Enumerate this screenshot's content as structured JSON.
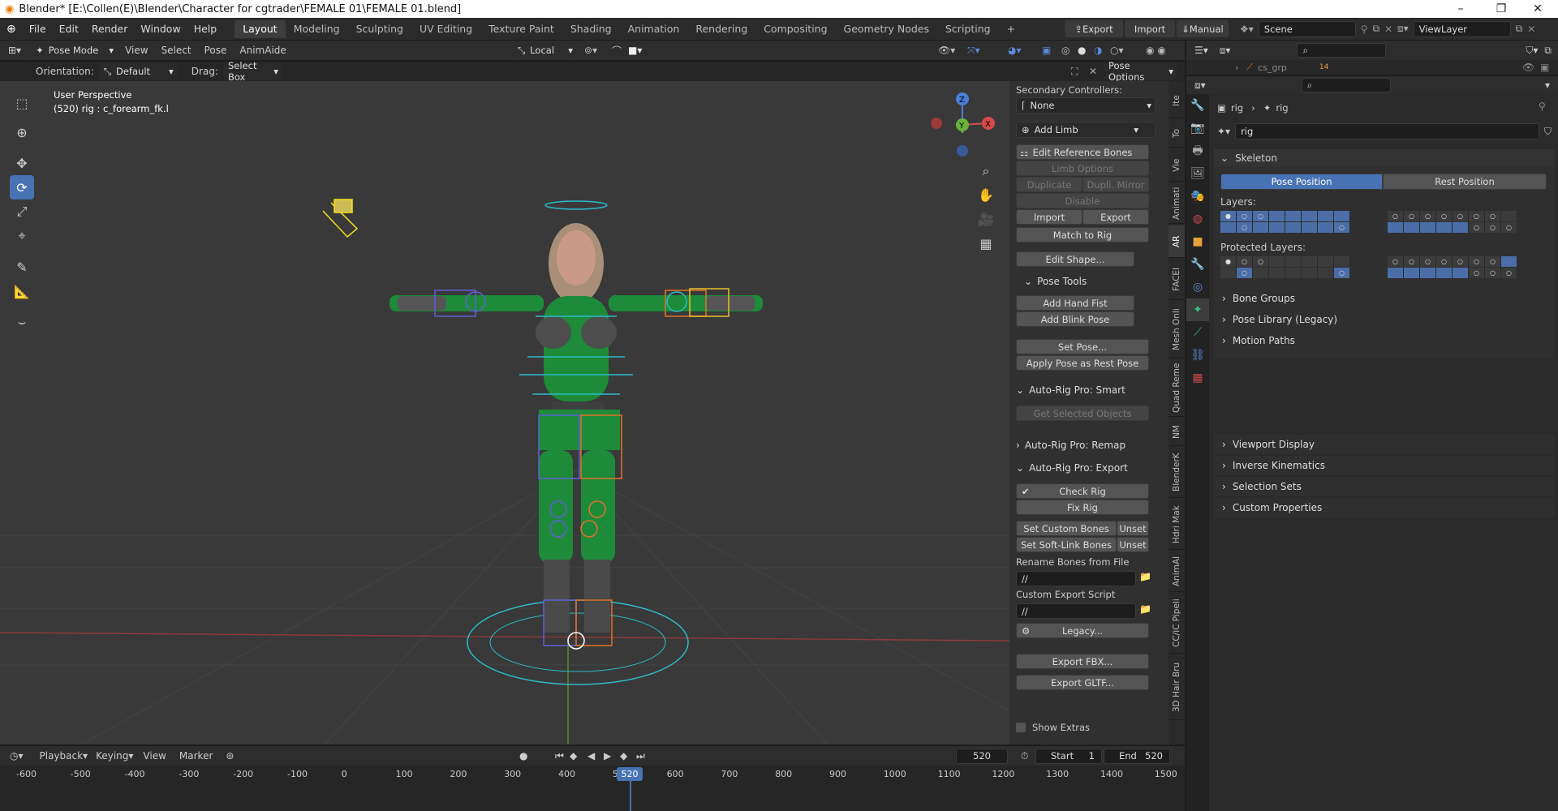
{
  "window": {
    "title": "Blender* [E:\\Collen(E)\\Blender\\Character for cgtrader\\FEMALE 01\\FEMALE 01.blend]",
    "minimize": "–",
    "maximize": "❐",
    "close": "✕"
  },
  "menu": [
    "File",
    "Edit",
    "Render",
    "Window",
    "Help"
  ],
  "workspaces": [
    "Layout",
    "Modeling",
    "Sculpting",
    "UV Editing",
    "Texture Paint",
    "Shading",
    "Animation",
    "Rendering",
    "Compositing",
    "Geometry Nodes",
    "Scripting"
  ],
  "workspace_add": "+",
  "topright": {
    "export": "Export",
    "import": "Import",
    "manual": "Manual",
    "scene": "Scene",
    "viewlayer": "ViewLayer"
  },
  "viewport_header": {
    "mode": "Pose Mode",
    "menus": [
      "View",
      "Select",
      "Pose",
      "AnimAide"
    ],
    "transform": "Local"
  },
  "tool_settings": {
    "orientation_label": "Orientation:",
    "orientation": "Default",
    "drag_label": "Drag:",
    "drag": "Select Box",
    "pose_options": "Pose Options"
  },
  "viewport": {
    "title": "User Perspective",
    "subtitle": "(520) rig : c_forearm_fk.l",
    "accent": "#4772b3",
    "axis_x": "X",
    "axis_y": "Y",
    "axis_z": "Z"
  },
  "npanel": {
    "secondary_label": "Secondary Controllers:",
    "secondary_value": "None",
    "add_limb": "Add Limb",
    "edit_ref": "Edit Reference Bones",
    "limb_options": "Limb Options",
    "duplicate": "Duplicate",
    "dupli_mirror": "Dupli. Mirror",
    "disable": "Disable",
    "import": "Import",
    "export": "Export",
    "match": "Match to Rig",
    "edit_shape": "Edit Shape...",
    "pose_tools": "Pose Tools",
    "add_hand_fist": "Add Hand Fist",
    "add_blink": "Add Blink Pose",
    "set_pose": "Set Pose...",
    "apply_pose": "Apply Pose as Rest Pose",
    "smart": "Auto-Rig Pro: Smart",
    "get_selected": "Get Selected Objects",
    "remap": "Auto-Rig Pro: Remap",
    "export_sec": "Auto-Rig Pro: Export",
    "check_rig": "Check Rig",
    "fix_rig": "Fix Rig",
    "set_custom": "Set Custom Bones",
    "unset": "Unset",
    "set_soft": "Set Soft-Link Bones",
    "rename_label": "Rename Bones from File",
    "rename_path": "//",
    "script_label": "Custom Export Script",
    "script_path": "//",
    "legacy": "Legacy...",
    "export_fbx": "Export FBX...",
    "export_gltf": "Export GLTF...",
    "show_extras": "Show Extras"
  },
  "side_tabs": [
    "Ite",
    "To",
    "Vie",
    "Animati",
    "AR",
    "FACEI",
    "Mesh Onli",
    "Quad Reme",
    "NM",
    "BlenderK",
    "Hdri Mak",
    "AnimAl",
    "CC/iC Pipeli",
    "3D Hair Bru"
  ],
  "outliner": {
    "row": "cs_grp",
    "badge": "14"
  },
  "properties": {
    "breadcrumb": [
      "rig",
      "rig"
    ],
    "name": "rig",
    "skeleton": "Skeleton",
    "pose_position": "Pose Position",
    "rest_position": "Rest Position",
    "layers": "Layers:",
    "protected": "Protected Layers:",
    "panels": [
      "Bone Groups",
      "Pose Library (Legacy)",
      "Motion Paths",
      "Viewport Display",
      "Inverse Kinematics",
      "Selection Sets",
      "Custom Properties"
    ]
  },
  "timeline": {
    "menus": [
      "Playback",
      "Keying",
      "View",
      "Marker"
    ],
    "current": "520",
    "start_label": "Start",
    "start": "1",
    "end_label": "End",
    "end": "520",
    "ruler": [
      "-600",
      "-500",
      "-400",
      "-300",
      "-200",
      "-100",
      "0",
      "100",
      "200",
      "300",
      "400",
      "5",
      "600",
      "700",
      "800",
      "900",
      "1000",
      "1100",
      "1200",
      "1300",
      "1400",
      "1500"
    ],
    "playhead": "520"
  }
}
